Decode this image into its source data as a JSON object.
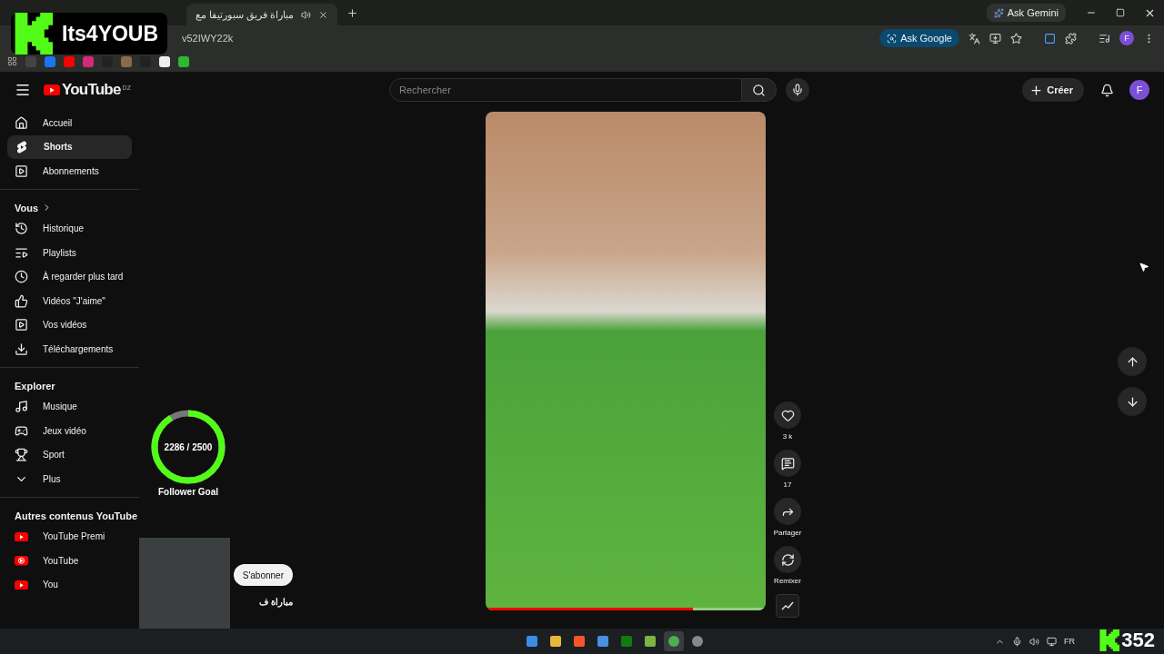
{
  "browser": {
    "tab": {
      "title": "مباراة فريق سبورتيفا مع"
    },
    "gemini_button": "Ask Gemini",
    "address": "v52IWY22k",
    "ask_google": "Ask Google",
    "profile_initial": "F"
  },
  "header": {
    "logo": "YouTube",
    "country": "DZ",
    "search_placeholder": "Rechercher",
    "create_button": "Créer",
    "avatar_initial": "F"
  },
  "sidebar": {
    "sections": [
      {
        "items": [
          {
            "label": "Accueil",
            "selected": false
          },
          {
            "label": "Shorts",
            "selected": true
          },
          {
            "label": "Abonnements",
            "selected": false
          }
        ]
      },
      {
        "title": "Vous",
        "items": [
          {
            "label": "Historique",
            "selected": false
          },
          {
            "label": "Playlists",
            "selected": false
          },
          {
            "label": "À regarder plus tard",
            "selected": false
          },
          {
            "label": "Vidéos \"J'aime\"",
            "selected": false
          },
          {
            "label": "Vos vidéos",
            "selected": false
          },
          {
            "label": "Téléchargements",
            "selected": false
          }
        ]
      },
      {
        "title": "Explorer",
        "items": [
          {
            "label": "Musique",
            "selected": false
          },
          {
            "label": "Jeux vidéo",
            "selected": false
          },
          {
            "label": "Sport",
            "selected": false
          },
          {
            "label": "Plus",
            "selected": false
          }
        ]
      },
      {
        "title": "Autres contenus YouTube",
        "items": [
          {
            "label": "YouTube Premi",
            "selected": false
          },
          {
            "label": "YouTube",
            "selected": false
          },
          {
            "label": "You",
            "selected": false
          }
        ]
      }
    ]
  },
  "short": {
    "progress": {
      "level": 0.74
    },
    "subscribe_button": "S'abonner",
    "title_fragment": "مباراة ف",
    "actions": [
      {
        "kind": "like",
        "label": "3 k"
      },
      {
        "kind": "comment",
        "label": "17"
      },
      {
        "kind": "share",
        "label": "Partager"
      },
      {
        "kind": "remix",
        "label": "Remixer"
      }
    ]
  },
  "overlay": {
    "streamer": "Its4YOUB",
    "follower_goal": {
      "label": "Follower Goal",
      "count": "2286 / 2500",
      "level": 0.914
    },
    "counter": "352"
  },
  "taskbar": {
    "apps": [
      {
        "selected": false
      },
      {
        "selected": false
      },
      {
        "selected": false
      },
      {
        "selected": false
      },
      {
        "selected": false
      },
      {
        "selected": false
      },
      {
        "selected": true
      },
      {
        "selected": false
      }
    ],
    "language": "FR"
  }
}
